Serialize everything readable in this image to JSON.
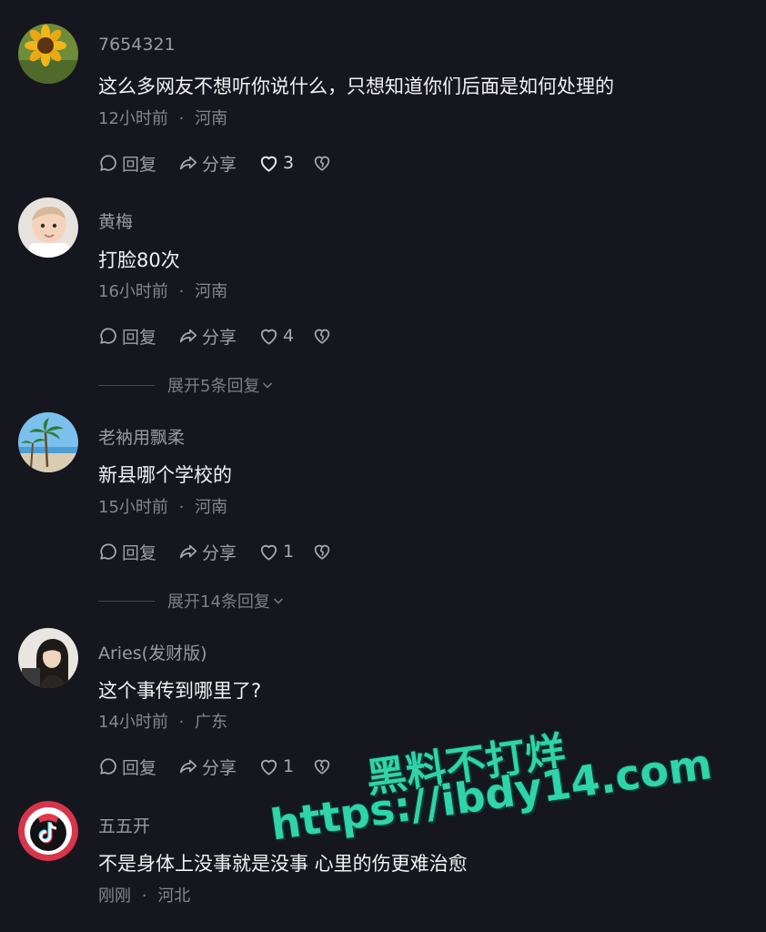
{
  "comments": [
    {
      "username": "7654321",
      "text": "这么多网友不想听你说什么，只想知道你们后面是如何处理的",
      "time": "12小时前",
      "location": "河南",
      "reply_label": "回复",
      "share_label": "分享",
      "likes": "3",
      "avatar_icon": "sunflower-avatar"
    },
    {
      "username": "黄梅",
      "text": "打脸80次",
      "time": "16小时前",
      "location": "河南",
      "reply_label": "回复",
      "share_label": "分享",
      "likes": "4",
      "expand_label": "展开5条回复",
      "avatar_icon": "baby-avatar"
    },
    {
      "username": "老衲用飘柔",
      "text": "新县哪个学校的",
      "time": "15小时前",
      "location": "河南",
      "reply_label": "回复",
      "share_label": "分享",
      "likes": "1",
      "expand_label": "展开14条回复",
      "avatar_icon": "palm-beach-avatar"
    },
    {
      "username": "Aries(发财版)",
      "text": "这个事传到哪里了?",
      "time": "14小时前",
      "location": "广东",
      "reply_label": "回复",
      "share_label": "分享",
      "likes": "1",
      "avatar_icon": "woman-avatar"
    },
    {
      "username": "五五开",
      "text": "不是身体上没事就是没事 心里的伤更难治愈",
      "time": "刚刚",
      "location": "河北",
      "avatar_icon": "tiktok-logo-avatar"
    }
  ],
  "separator": "·",
  "watermark": {
    "line1": "黑料不打烊",
    "line2": "https://ibdy14.com",
    "color": "#2fd4a8"
  }
}
